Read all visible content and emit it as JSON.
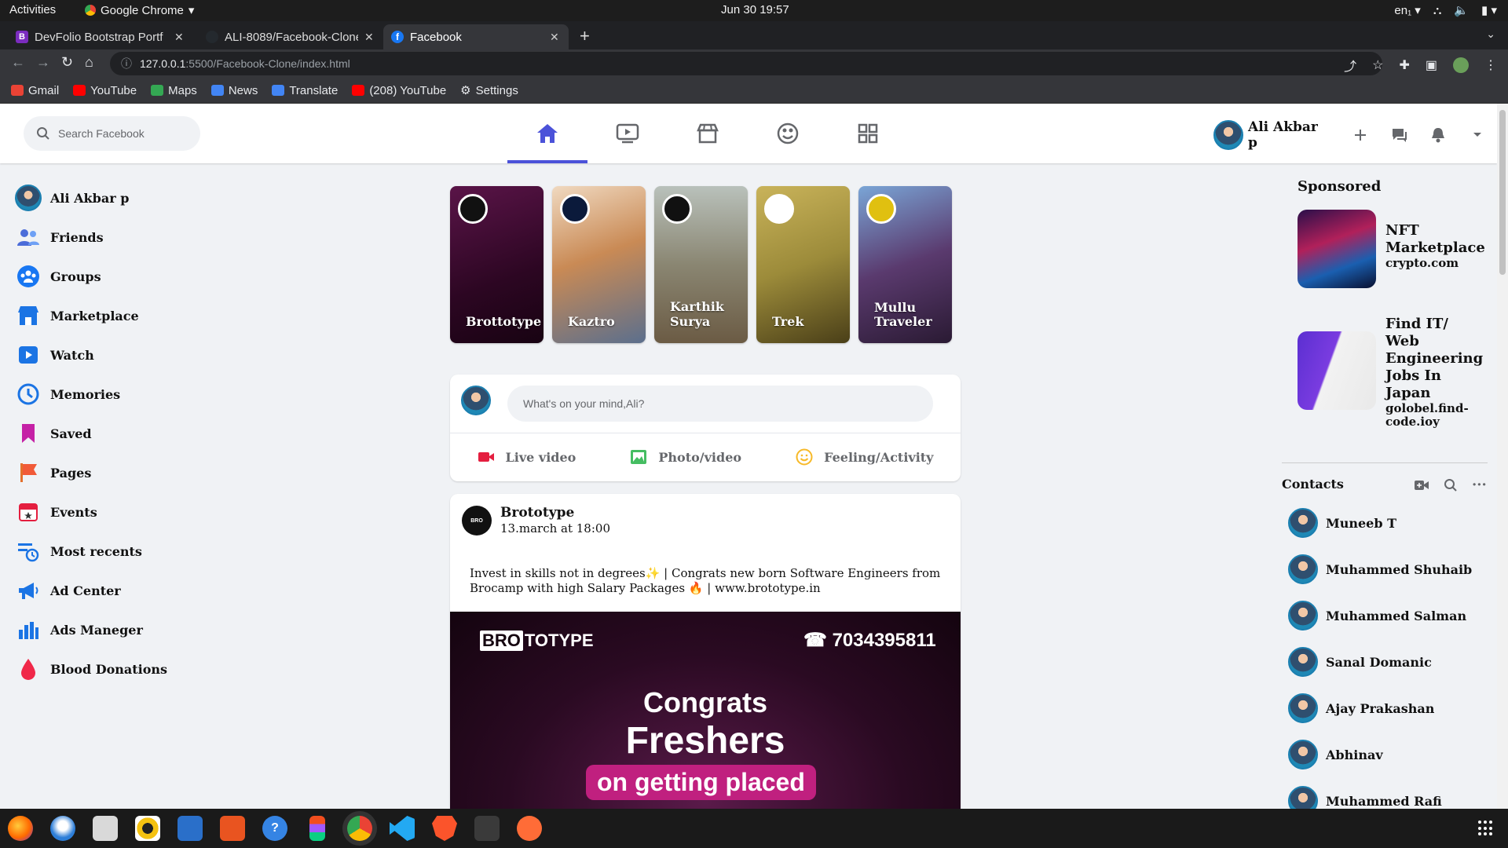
{
  "system": {
    "activities": "Activities",
    "app_name": "Google Chrome",
    "clock": "Jun 30  19:57",
    "lang": "en₁"
  },
  "tabs": [
    {
      "title": "DevFolio Bootstrap Portf",
      "color": "#7b2cbf",
      "fav_letter": "B"
    },
    {
      "title": "ALI-8089/Facebook-Clone",
      "color": "#24292e",
      "fav_letter": ""
    },
    {
      "title": "Facebook",
      "color": "#1877f2",
      "fav_letter": "f"
    }
  ],
  "toolbar": {
    "url_host": "127.0.0.1",
    "url_path": ":5500/Facebook-Clone/index.html"
  },
  "bookmarks": [
    {
      "label": "Gmail",
      "color": "#ea4335"
    },
    {
      "label": "YouTube",
      "color": "#ff0000"
    },
    {
      "label": "Maps",
      "color": "#34a853"
    },
    {
      "label": "News",
      "color": "#4285f4"
    },
    {
      "label": "Translate",
      "color": "#4285f4"
    },
    {
      "label": "(208) YouTube",
      "color": "#ff0000"
    },
    {
      "label": "Settings",
      "color": "#e8eaed"
    }
  ],
  "header": {
    "search_placeholder": "Search Facebook",
    "user_name": "Ali Akbar p",
    "accent": "#4b52d9"
  },
  "sidebar": {
    "items": [
      {
        "label": "Ali Akbar p",
        "icon": "avatar"
      },
      {
        "label": "Friends",
        "icon": "friends-icon"
      },
      {
        "label": "Groups",
        "icon": "groups-icon"
      },
      {
        "label": "Marketplace",
        "icon": "marketplace-icon"
      },
      {
        "label": "Watch",
        "icon": "watch-icon"
      },
      {
        "label": "Memories",
        "icon": "memories-icon"
      },
      {
        "label": "Saved",
        "icon": "saved-icon"
      },
      {
        "label": "Pages",
        "icon": "pages-icon"
      },
      {
        "label": "Events",
        "icon": "events-icon"
      },
      {
        "label": "Most recents",
        "icon": "most-recents-icon"
      },
      {
        "label": "Ad Center",
        "icon": "ad-center-icon"
      },
      {
        "label": "Ads Maneger",
        "icon": "ads-manager-icon"
      },
      {
        "label": "Blood Donations",
        "icon": "blood-donations-icon"
      }
    ]
  },
  "stories": [
    {
      "name": "Brottotype",
      "bg": "#3a0a2c"
    },
    {
      "name": "Kaztro",
      "bg": "#c98a55"
    },
    {
      "name": "Karthik Surya",
      "bg": "#7b7a6a"
    },
    {
      "name": "Trek",
      "bg": "#9c8b3a"
    },
    {
      "name": "Mullu Traveler",
      "bg": "#5a3a6e"
    }
  ],
  "composer": {
    "placeholder": "What's on your mind,Ali?",
    "actions": [
      {
        "label": "Live video",
        "color": "#e41e3f"
      },
      {
        "label": "Photo/video",
        "color": "#45bd62"
      },
      {
        "label": "Feeling/Activity",
        "color": "#f7b928"
      }
    ]
  },
  "post": {
    "author": "Brototype",
    "time": "13.march at 18:00",
    "text": "Invest in skills not in degrees✨ | Congrats new born Software Engineers from Brocamp with high Salary Packages 🔥 | www.brototype.in",
    "image": {
      "brand_box": "BRO",
      "brand_rest": "TOTYPE",
      "phone": "☎ 7034395811",
      "line1": "Congrats",
      "line2": "Freshers",
      "line3": "on getting placed"
    }
  },
  "sponsored": {
    "title": "Sponsored",
    "ads": [
      {
        "title": "NFT Marketplace",
        "domain": "crypto.com"
      },
      {
        "title": "Find IT/ Web Engineering Jobs In Japan",
        "domain": "golobel.find-code.ioy"
      }
    ]
  },
  "contacts": {
    "title": "Contacts",
    "list": [
      "Muneeb T",
      "Muhammed Shuhaib",
      "Muhammed Salman",
      "Sanal Domanic",
      "Ajay Prakashan",
      "Abhinav",
      "Muhammed Rafi"
    ]
  }
}
